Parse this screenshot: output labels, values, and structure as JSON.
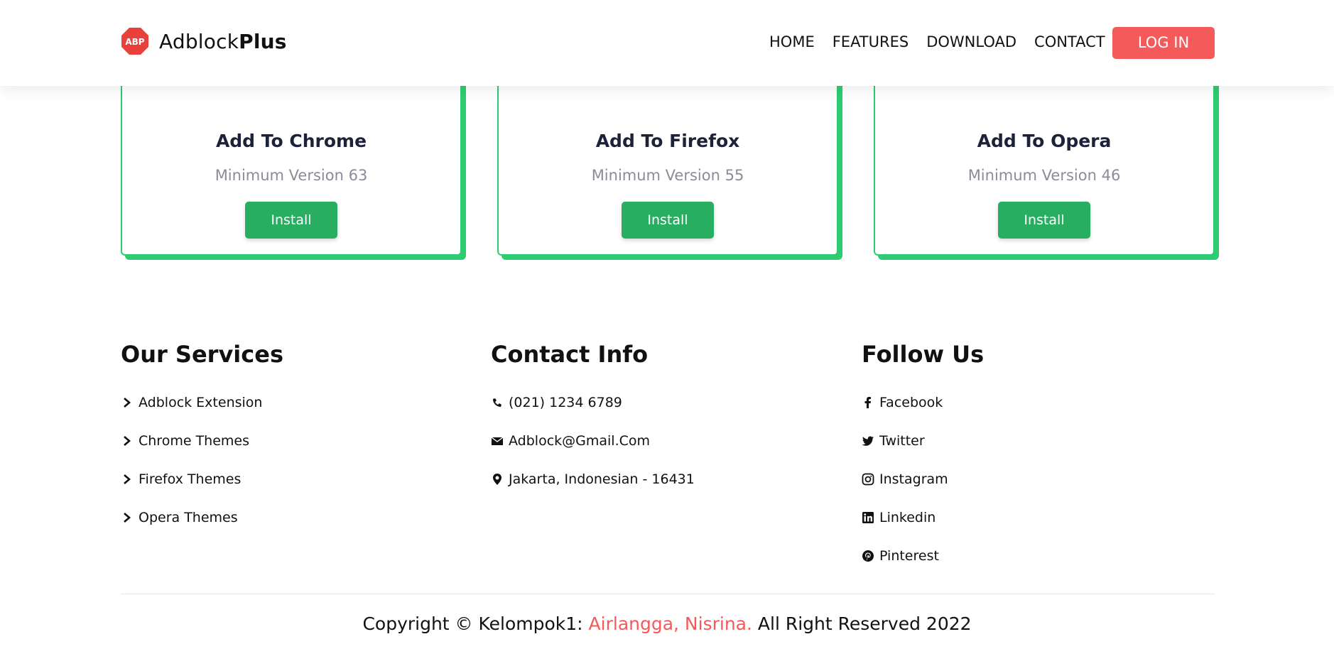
{
  "brand": {
    "name_regular": "Adblock",
    "name_bold": "Plus",
    "badge_text": "ABP",
    "badge_color": "#e8413c"
  },
  "nav": {
    "items": [
      "HOME",
      "FEATURES",
      "DOWNLOAD",
      "CONTACT"
    ],
    "login_label": "LOG IN"
  },
  "cards": [
    {
      "title": "Add To Chrome",
      "min_version": "Minimum Version 63",
      "install_label": "Install",
      "icon": "chrome-icon"
    },
    {
      "title": "Add To Firefox",
      "min_version": "Minimum Version 55",
      "install_label": "Install",
      "icon": "firefox-icon"
    },
    {
      "title": "Add To Opera",
      "min_version": "Minimum Version 46",
      "install_label": "Install",
      "icon": "opera-icon"
    }
  ],
  "footer": {
    "services": {
      "heading": "Our Services",
      "items": [
        "Adblock Extension",
        "Chrome Themes",
        "Firefox Themes",
        "Opera Themes"
      ]
    },
    "contact": {
      "heading": "Contact Info",
      "phone": "(021) 1234 6789",
      "email": "Adblock@Gmail.Com",
      "address": "Jakarta, Indonesian - 16431"
    },
    "follow": {
      "heading": "Follow Us",
      "items": [
        "Facebook",
        "Twitter",
        "Instagram",
        "Linkedin",
        "Pinterest"
      ]
    },
    "copyright": {
      "prefix": "Copyright © Kelompok1: ",
      "names": "Airlangga, Nisrina.",
      "suffix": " All Right Reserved 2022"
    }
  },
  "colors": {
    "accent_green": "#27ae60",
    "card_border": "#2ecc71",
    "login_red": "#f55a5a"
  }
}
